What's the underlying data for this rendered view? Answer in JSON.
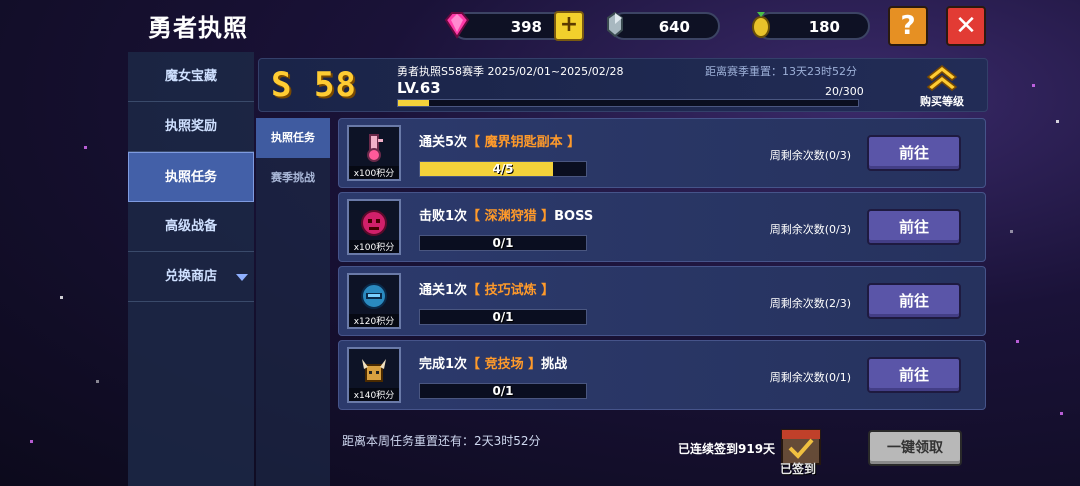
{
  "header": {
    "title": "勇者执照",
    "gems": "398",
    "crystals": "640",
    "seeds": "180",
    "help_label": "?",
    "close_label": "✕"
  },
  "sidebar": {
    "items": [
      {
        "label": "魔女宝藏"
      },
      {
        "label": "执照奖励"
      },
      {
        "label": "执照任务"
      },
      {
        "label": "高级战备"
      },
      {
        "label": "兑换商店"
      }
    ]
  },
  "subnav": {
    "items": [
      {
        "label": "执照任务"
      },
      {
        "label": "赛季挑战"
      }
    ]
  },
  "season": {
    "badge": "S 58",
    "title": "勇者执照S58赛季 2025/02/01~2025/02/28",
    "reset": "距离赛季重置：13天23时52分",
    "level": "LV.63",
    "xp": "20/300",
    "xp_fraction": 0.067,
    "buy_label": "购买等级"
  },
  "tasks": [
    {
      "prefix": "通关5次",
      "highlight": "【 魔界钥匙副本 】",
      "suffix": "",
      "points": "x100积分",
      "progress": "4/5",
      "fraction": 0.8,
      "remain": "周剩余次数(0/3)",
      "go": "前往"
    },
    {
      "prefix": "击败1次",
      "highlight": "【 深渊狩猎 】",
      "suffix": "BOSS",
      "points": "x100积分",
      "progress": "0/1",
      "fraction": 0,
      "remain": "周剩余次数(0/3)",
      "go": "前往"
    },
    {
      "prefix": "通关1次",
      "highlight": "【 技巧试炼 】",
      "suffix": "",
      "points": "x120积分",
      "progress": "0/1",
      "fraction": 0,
      "remain": "周剩余次数(2/3)",
      "go": "前往"
    },
    {
      "prefix": "完成1次",
      "highlight": "【 竞技场 】",
      "suffix": "挑战",
      "points": "x140积分",
      "progress": "0/1",
      "fraction": 0,
      "remain": "周剩余次数(0/1)",
      "go": "前往"
    }
  ],
  "footer": {
    "weekly_reset": "距离本周任务重置还有：2天3时52分",
    "streak": "已连续签到919天",
    "signed": "已签到",
    "claim_all": "一键领取"
  },
  "colors": {
    "accent": "#f4d23a",
    "highlight": "#ff9a2a",
    "go_button": "#5a55a8",
    "close": "#e23b34",
    "help": "#e69023"
  }
}
